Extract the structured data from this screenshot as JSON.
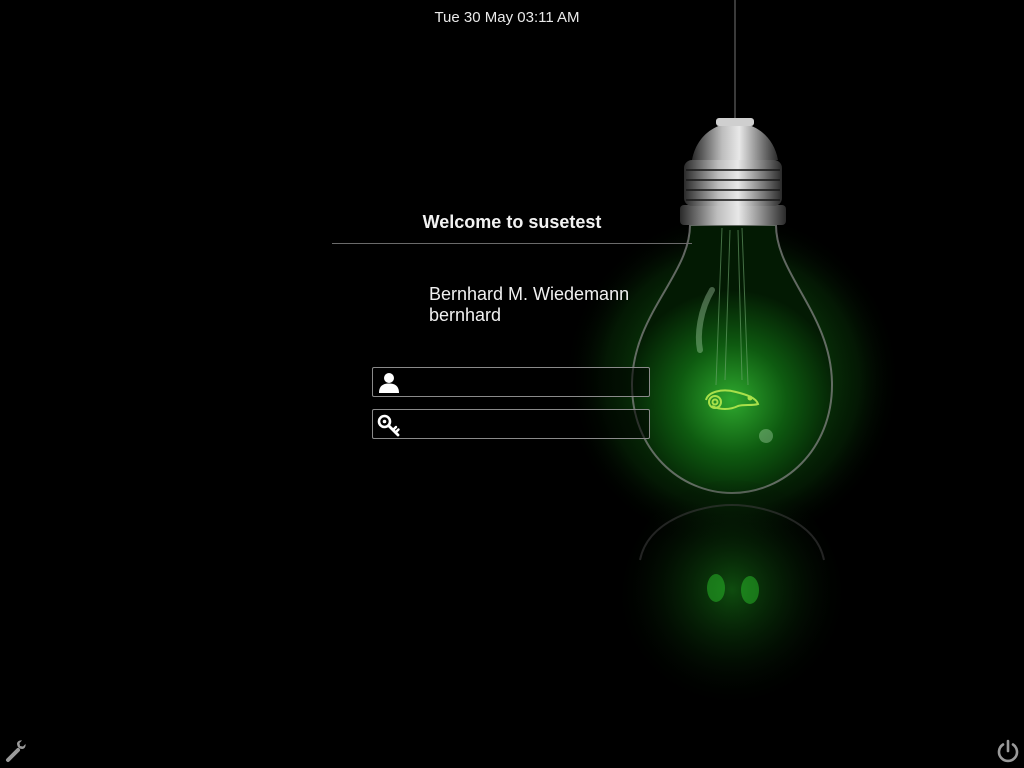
{
  "header": {
    "datetime": "Tue 30 May 03:11 AM"
  },
  "login": {
    "welcome": "Welcome to susetest",
    "user_fullname": "Bernhard M. Wiedemann",
    "user_login": "bernhard",
    "username_value": "",
    "password_value": "",
    "username_icon": "user-icon",
    "password_icon": "key-icon"
  },
  "footer": {
    "settings_icon": "wrench-icon",
    "power_icon": "power-icon"
  },
  "colors": {
    "background": "#000000",
    "bulb_glow": "#2fbf2f",
    "chameleon": "#a8e04a",
    "text": "#ffffff"
  }
}
